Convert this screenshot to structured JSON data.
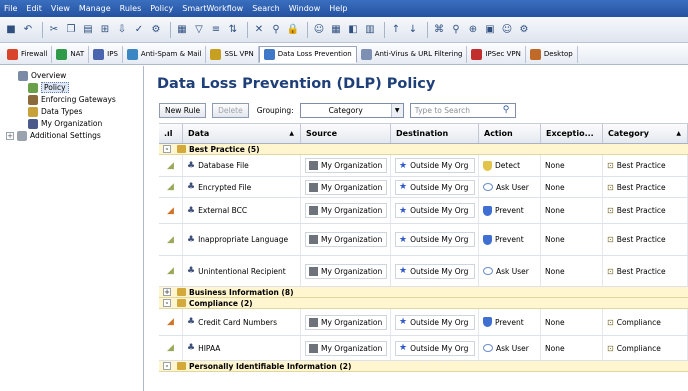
{
  "menu": [
    "File",
    "Edit",
    "View",
    "Manage",
    "Rules",
    "Policy",
    "SmartWorkflow",
    "Search",
    "Window",
    "Help"
  ],
  "toolbar_icons": [
    "save-icon",
    "undo-icon",
    "cut-icon",
    "copy-icon",
    "paste-icon",
    "tree-icon",
    "install-icon",
    "verify-icon",
    "gear-icon",
    "grid-icon",
    "filter-icon",
    "rules-icon",
    "sort-icon",
    "close-icon",
    "find-icon",
    "lock-icon",
    "users-icon",
    "table-icon",
    "view-icon",
    "columns-icon",
    "sort-asc-icon",
    "sort-desc-icon",
    "network-icon",
    "search-icon",
    "zoom-icon",
    "database-icon",
    "user-icon",
    "settings-icon"
  ],
  "blades": [
    {
      "label": "Firewall",
      "color": "#d9452b"
    },
    {
      "label": "NAT",
      "color": "#2f9a4a"
    },
    {
      "label": "IPS",
      "color": "#4a64b0"
    },
    {
      "label": "Anti-Spam & Mail",
      "color": "#3b87c4"
    },
    {
      "label": "SSL VPN",
      "color": "#c8a021"
    },
    {
      "label": "Data Loss Prevention",
      "color": "#3f78c7",
      "active": true
    },
    {
      "label": "Anti-Virus & URL Filtering",
      "color": "#7d8fb3"
    },
    {
      "label": "IPSec VPN",
      "color": "#c22e2e"
    },
    {
      "label": "Desktop",
      "color": "#c06a2a"
    }
  ],
  "sidebar": [
    {
      "label": "Overview",
      "icon": "overview-icon",
      "color": "#7a8aa6",
      "indent": 18
    },
    {
      "label": "Policy",
      "icon": "policy-icon",
      "color": "#6aa04a",
      "indent": 28,
      "selected": true
    },
    {
      "label": "Enforcing Gateways",
      "icon": "gateway-icon",
      "color": "#8a6a3a",
      "indent": 28
    },
    {
      "label": "Data Types",
      "icon": "data-types-icon",
      "color": "#c7a23a",
      "indent": 28
    },
    {
      "label": "My Organization",
      "icon": "organization-icon",
      "color": "#4a5a8a",
      "indent": 28
    },
    {
      "label": "Additional Settings",
      "icon": "settings-icon",
      "color": "#9aa2ad",
      "indent": 6,
      "expander": "+"
    }
  ],
  "page_title": "Data Loss Prevention (DLP) Policy",
  "controls": {
    "new_rule": "New Rule",
    "delete": "Delete",
    "grouping_label": "Grouping:",
    "grouping_value": "Category",
    "search_placeholder": "Type to Search"
  },
  "columns": [
    "",
    "Data",
    "Source",
    "Destination",
    "Action",
    "Exceptio...",
    "Category"
  ],
  "groups": [
    {
      "label": "Best Practice (5)",
      "expander": "-",
      "rows": [
        {
          "flag": "#9aa85a",
          "data": "Database File",
          "source": "My Organization",
          "destination": "Outside My Org",
          "action": "Detect",
          "action_icon": "#e2c44a",
          "action_kind": "shield",
          "exceptions": "None",
          "category": "Best Practice",
          "height": 22
        },
        {
          "flag": "#9aa85a",
          "data": "Encrypted File",
          "source": "My Organization",
          "destination": "Outside My Org",
          "action": "Ask User",
          "action_icon": "#6b8ccf",
          "action_kind": "bubble",
          "exceptions": "None",
          "category": "Best Practice",
          "height": 21
        },
        {
          "flag": "#d0742a",
          "data": "External BCC",
          "source": "My Organization",
          "destination": "Outside My Org",
          "action": "Prevent",
          "action_icon": "#3f6fd0",
          "action_kind": "shield",
          "exceptions": "None",
          "category": "Best Practice",
          "height": 26
        },
        {
          "flag": "#9aa85a",
          "data": "Inappropriate Language",
          "source": "My Organization",
          "destination": "Outside My Org",
          "action": "Prevent",
          "action_icon": "#3f6fd0",
          "action_kind": "shield",
          "exceptions": "None",
          "category": "Best Practice",
          "height": 32
        },
        {
          "flag": "#9aa85a",
          "data": "Unintentional Recipient",
          "source": "My Organization",
          "destination": "Outside My Org",
          "action": "Ask User",
          "action_icon": "#6b8ccf",
          "action_kind": "bubble",
          "exceptions": "None",
          "category": "Best Practice",
          "height": 31
        }
      ]
    },
    {
      "label": "Business Information (8)",
      "expander": "+",
      "rows": []
    },
    {
      "label": "Compliance (2)",
      "expander": "-",
      "rows": [
        {
          "flag": "#d0742a",
          "data": "Credit Card Numbers",
          "source": "My Organization",
          "destination": "Outside My Org",
          "action": "Prevent",
          "action_icon": "#3f6fd0",
          "action_kind": "shield",
          "exceptions": "None",
          "category": "Compliance",
          "height": 27
        },
        {
          "flag": "#9aa85a",
          "data": "HIPAA",
          "source": "My Organization",
          "destination": "Outside My Org",
          "action": "Ask User",
          "action_icon": "#6b8ccf",
          "action_kind": "bubble",
          "exceptions": "None",
          "category": "Compliance",
          "height": 25
        }
      ]
    },
    {
      "label": "Personally Identifiable Information (2)",
      "expander": "-",
      "rows": []
    }
  ]
}
